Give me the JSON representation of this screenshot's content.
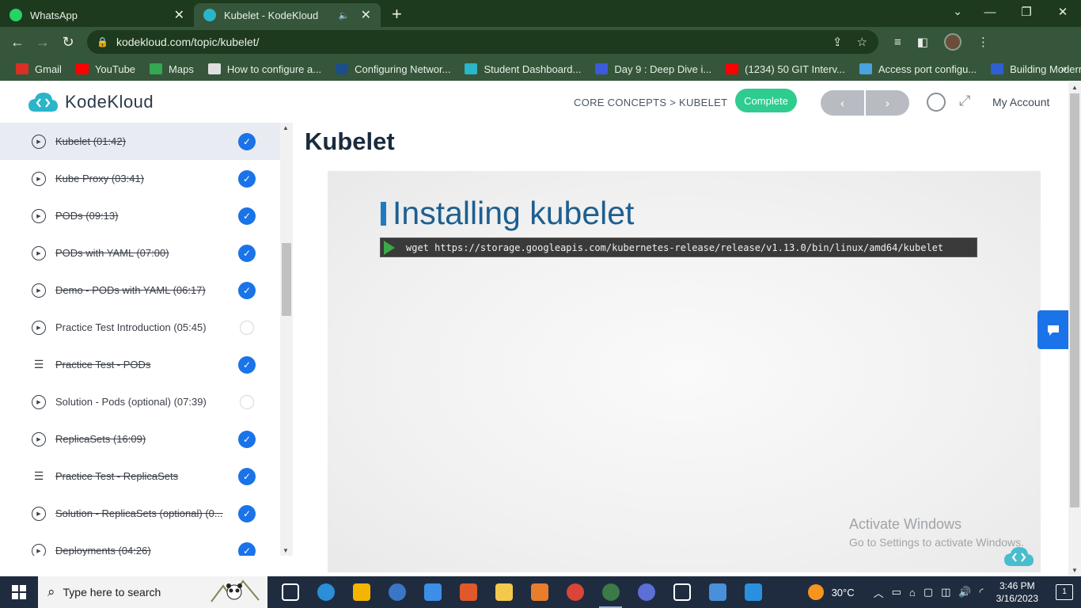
{
  "browser": {
    "tabs": [
      {
        "title": "WhatsApp",
        "active": false
      },
      {
        "title": "Kubelet - KodeKloud",
        "active": true
      }
    ],
    "url": "kodekloud.com/topic/kubelet/",
    "bookmarks": [
      {
        "label": "Gmail",
        "icon": "gmail-icon",
        "color": "#d93025"
      },
      {
        "label": "YouTube",
        "icon": "youtube-icon",
        "color": "#ff0000"
      },
      {
        "label": "Maps",
        "icon": "maps-icon",
        "color": "#34a853"
      },
      {
        "label": "How to configure a...",
        "icon": "page-icon",
        "color": "#e0e0e0"
      },
      {
        "label": "Configuring Networ...",
        "icon": "vmware-icon",
        "color": "#1d4e89"
      },
      {
        "label": "Student Dashboard...",
        "icon": "cloud-icon",
        "color": "#2bb5c8"
      },
      {
        "label": "Day 9 : Deep Dive i...",
        "icon": "diamond-icon",
        "color": "#3b5bdb"
      },
      {
        "label": "(1234) 50 GIT Interv...",
        "icon": "youtube-icon",
        "color": "#ff0000"
      },
      {
        "label": "Access port configu...",
        "icon": "link-icon",
        "color": "#4aa3df"
      },
      {
        "label": "Building Modern Py...",
        "icon": "c-icon",
        "color": "#2f5fd0"
      }
    ]
  },
  "header": {
    "logo_text": "KodeKloud",
    "breadcrumb": "CORE CONCEPTS > KUBELET",
    "complete_label": "Complete",
    "prev_label": "‹",
    "next_label": "›",
    "account_label": "My Account"
  },
  "sidebar": {
    "items": [
      {
        "label": "Kubelet (01:42)",
        "type": "video",
        "done": true,
        "active": true
      },
      {
        "label": "Kube Proxy (03:41)",
        "type": "video",
        "done": true,
        "active": false
      },
      {
        "label": "PODs (09:13)",
        "type": "video",
        "done": true,
        "active": false
      },
      {
        "label": "PODs with YAML (07:00)",
        "type": "video",
        "done": true,
        "active": false
      },
      {
        "label": "Demo - PODs with YAML (06:17)",
        "type": "video",
        "done": true,
        "active": false
      },
      {
        "label": "Practice Test Introduction (05:45)",
        "type": "video",
        "done": false,
        "active": false
      },
      {
        "label": "Practice Test - PODs",
        "type": "list",
        "done": true,
        "active": false
      },
      {
        "label": "Solution - Pods (optional) (07:39)",
        "type": "video",
        "done": false,
        "active": false
      },
      {
        "label": "ReplicaSets (16:09)",
        "type": "video",
        "done": true,
        "active": false
      },
      {
        "label": "Practice Test - ReplicaSets",
        "type": "list",
        "done": true,
        "active": false
      },
      {
        "label": "Solution - ReplicaSets (optional) (0...",
        "type": "video",
        "done": true,
        "active": false
      },
      {
        "label": "Deployments (04:26)",
        "type": "video",
        "done": true,
        "active": false
      }
    ]
  },
  "main": {
    "title": "Kubelet",
    "slide_title": "Installing kubelet",
    "command": "wget https://storage.googleapis.com/kubernetes-release/release/v1.13.0/bin/linux/amd64/kubelet",
    "watermark_title": "Activate Windows",
    "watermark_sub": "Go to Settings to activate Windows."
  },
  "taskbar": {
    "search_placeholder": "Type here to search",
    "apps": [
      {
        "name": "task-view-icon",
        "color": "#ffffff",
        "active": false
      },
      {
        "name": "edge-icon",
        "color": "#2a8fd8",
        "active": false
      },
      {
        "name": "store-icon",
        "color": "#f4b400",
        "active": false
      },
      {
        "name": "skype-icon",
        "color": "#3a76c6",
        "active": false
      },
      {
        "name": "mail-icon",
        "color": "#3d8ee6",
        "active": false
      },
      {
        "name": "snail-icon",
        "color": "#e0592a",
        "active": false
      },
      {
        "name": "file-explorer-icon",
        "color": "#f2c94c",
        "active": false
      },
      {
        "name": "office-icon",
        "color": "#e87e2c",
        "active": false
      },
      {
        "name": "chrome-icon",
        "color": "#db4437",
        "active": false
      },
      {
        "name": "chrome-profile-icon",
        "color": "#3c7a47",
        "active": true
      },
      {
        "name": "chrome-h-icon",
        "color": "#5b6fd6",
        "active": false
      },
      {
        "name": "settings-icon",
        "color": "#ffffff",
        "active": false
      },
      {
        "name": "remote-desktop-icon",
        "color": "#4a90d9",
        "active": false
      },
      {
        "name": "vscode-icon",
        "color": "#2b8fe0",
        "active": false
      }
    ],
    "temperature": "30°C",
    "time": "3:46 PM",
    "date": "3/16/2023",
    "notification_count": "1"
  }
}
